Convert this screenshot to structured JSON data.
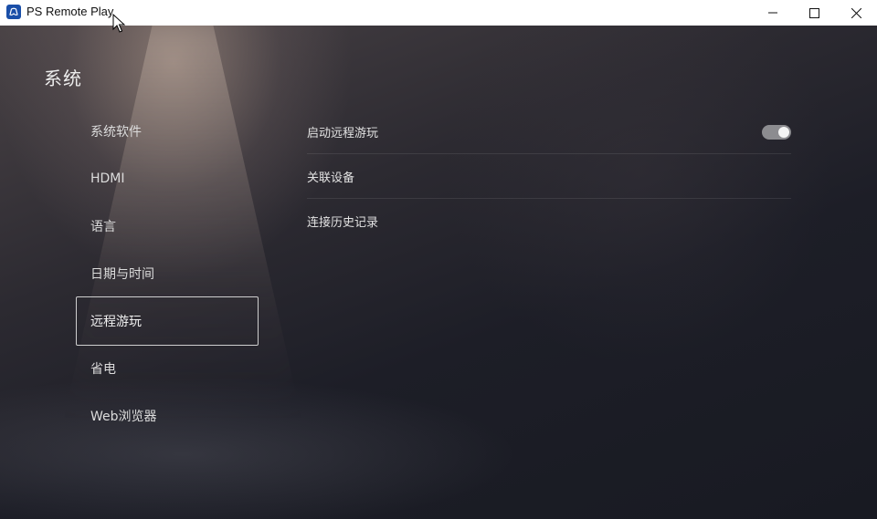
{
  "window": {
    "title": "PS Remote Play",
    "icon": "playstation-icon"
  },
  "page": {
    "title": "系统"
  },
  "nav": {
    "items": [
      {
        "label": "系统软件",
        "selected": false
      },
      {
        "label": "HDMI",
        "selected": false
      },
      {
        "label": "语言",
        "selected": false
      },
      {
        "label": "日期与时间",
        "selected": false
      },
      {
        "label": "远程游玩",
        "selected": true
      },
      {
        "label": "省电",
        "selected": false
      },
      {
        "label": "Web浏览器",
        "selected": false
      }
    ]
  },
  "settings": {
    "rows": [
      {
        "label": "启动远程游玩",
        "toggle": true,
        "toggle_on": true
      },
      {
        "label": "关联设备"
      },
      {
        "label": "连接历史记录"
      }
    ]
  },
  "colors": {
    "titlebar_bg": "#ffffff",
    "toggle_track": "#8c8c90",
    "selected_border": "#cfcfcf"
  }
}
